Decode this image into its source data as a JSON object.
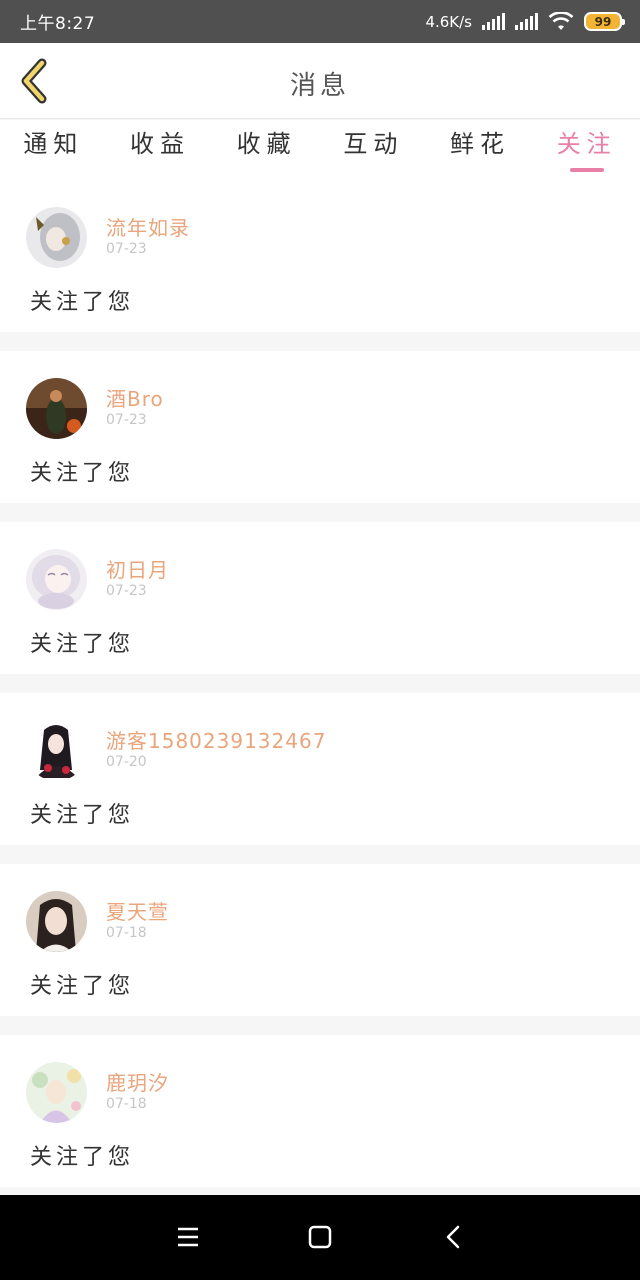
{
  "status_bar": {
    "time": "上午8:27",
    "net_speed": "4.6K/s",
    "battery": "99",
    "icons": [
      "signal-icon",
      "signal-icon",
      "wifi-icon",
      "battery-icon"
    ]
  },
  "header": {
    "title": "消息",
    "back_icon": "chevron-left-icon"
  },
  "tabs": [
    {
      "label": "通知"
    },
    {
      "label": "收益"
    },
    {
      "label": "收藏"
    },
    {
      "label": "互动"
    },
    {
      "label": "鲜花"
    },
    {
      "label": "关注",
      "active": true
    }
  ],
  "notifications": [
    {
      "username": "流年如录",
      "date": "07-23",
      "message": "关注了您"
    },
    {
      "username": "酒Bro",
      "date": "07-23",
      "message": "关注了您"
    },
    {
      "username": "初日月",
      "date": "07-23",
      "message": "关注了您"
    },
    {
      "username": "游客1580239132467",
      "date": "07-20",
      "message": "关注了您"
    },
    {
      "username": "夏天萱",
      "date": "07-18",
      "message": "关注了您"
    },
    {
      "username": "鹿玥汐",
      "date": "07-18",
      "message": "关注了您"
    }
  ],
  "nav_bar": {
    "icons": [
      "menu-icon",
      "home-icon",
      "back-icon"
    ]
  },
  "colors": {
    "accent": "#e87fa6",
    "username": "#e9a57c",
    "status_bar": "#505050",
    "battery": "#f3b436"
  }
}
